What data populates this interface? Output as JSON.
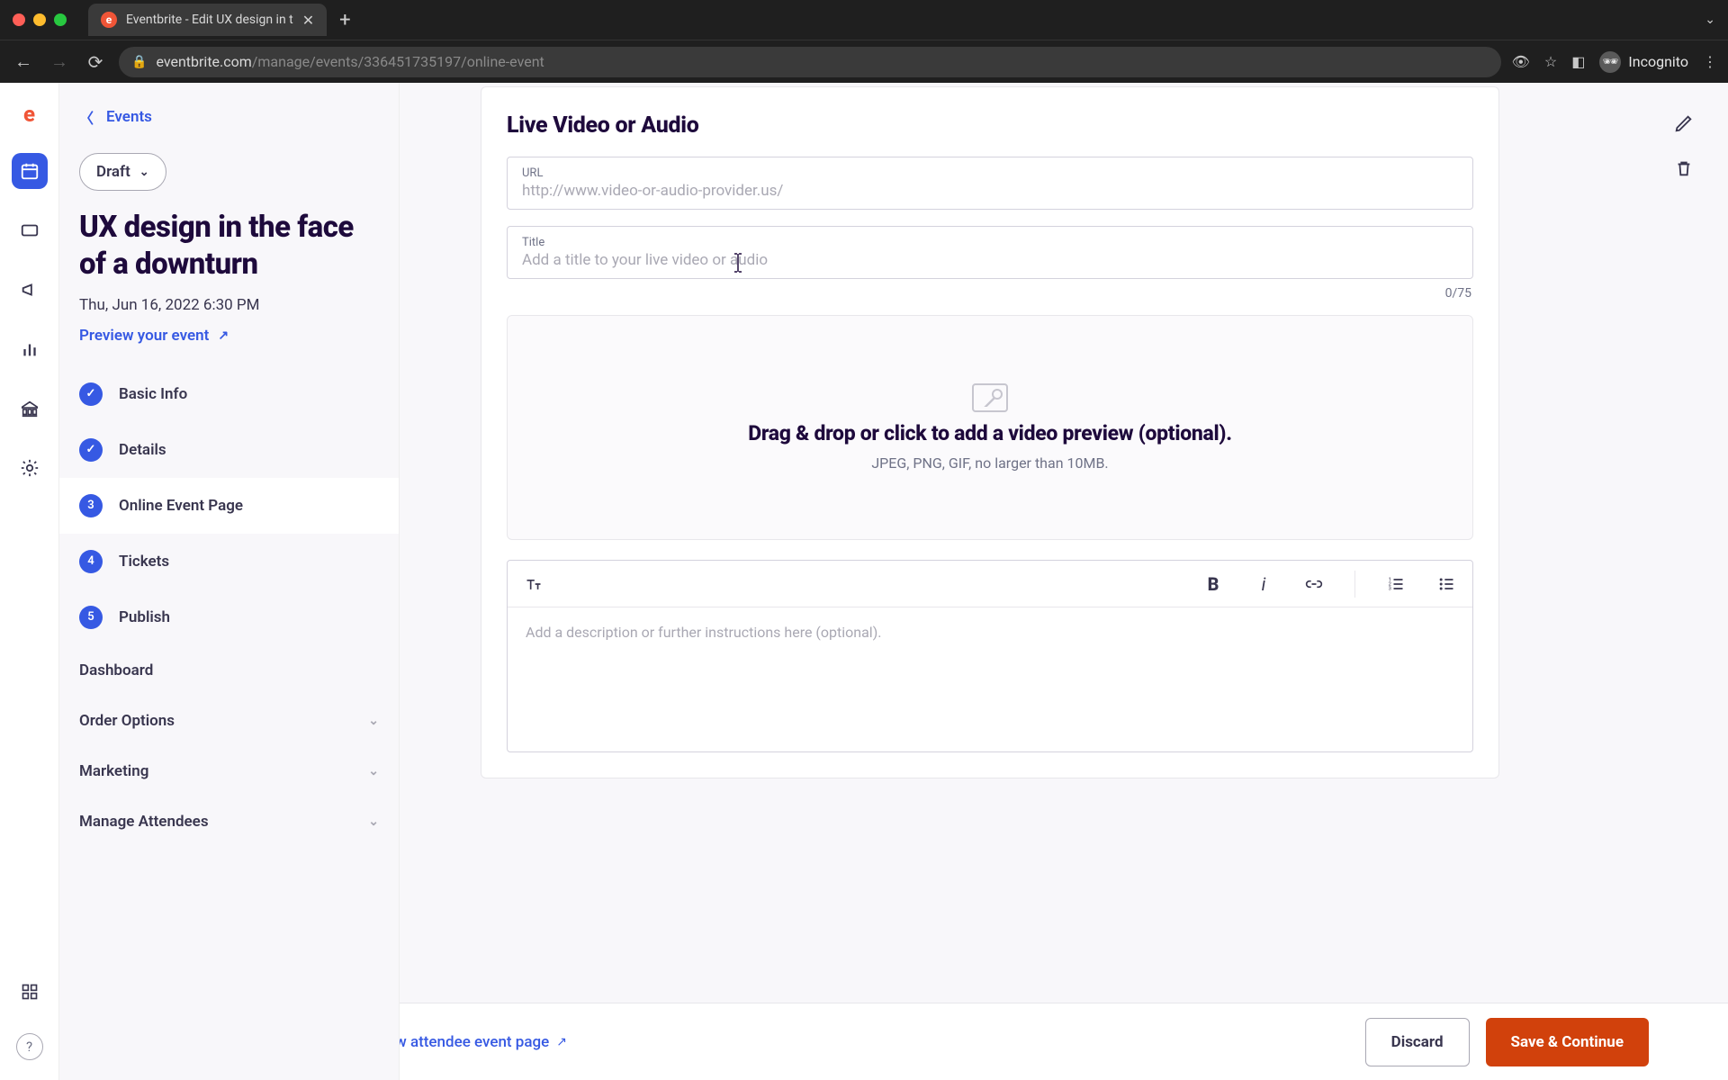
{
  "browser": {
    "tab_title": "Eventbrite - Edit UX design in t",
    "url_host": "eventbrite.com",
    "url_path": "/manage/events/336451735197/online-event",
    "incognito_label": "Incognito"
  },
  "sidebar": {
    "back_label": "Events",
    "status": "Draft",
    "event_title": "UX design in the face of a downturn",
    "event_datetime": "Thu, Jun 16, 2022 6:30 PM",
    "preview_label": "Preview your event",
    "steps": [
      {
        "label": "Basic Info",
        "badge": "check"
      },
      {
        "label": "Details",
        "badge": "check"
      },
      {
        "label": "Online Event Page",
        "badge": "3"
      },
      {
        "label": "Tickets",
        "badge": "4"
      },
      {
        "label": "Publish",
        "badge": "5"
      }
    ],
    "dashboard": "Dashboard",
    "order_options": "Order Options",
    "marketing": "Marketing",
    "manage_attendees": "Manage Attendees"
  },
  "content": {
    "section_title": "Live Video or Audio",
    "url_field_label": "URL",
    "url_placeholder": "http://www.video-or-audio-provider.us/",
    "title_field_label": "Title",
    "title_placeholder": "Add a title to your live video or audio",
    "title_counter": "0/75",
    "dropzone_main": "Drag & drop or click to add a video preview (optional).",
    "dropzone_sub": "JPEG, PNG, GIF, no larger than 10MB.",
    "rte_placeholder": "Add a description or further instructions here (optional)."
  },
  "footer": {
    "attendee_link": "ew attendee event page",
    "discard": "Discard",
    "save": "Save & Continue"
  }
}
